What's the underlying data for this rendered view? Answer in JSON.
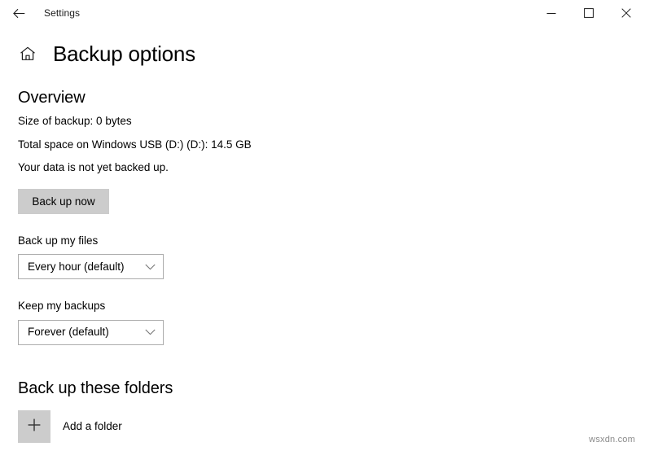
{
  "titlebar": {
    "back_icon": "arrow-left-icon",
    "title": "Settings",
    "minimize_icon": "minimize-icon",
    "maximize_icon": "maximize-icon",
    "close_icon": "close-icon"
  },
  "header": {
    "home_icon": "home-icon",
    "title": "Backup options"
  },
  "overview": {
    "heading": "Overview",
    "size_of_backup": "Size of backup: 0 bytes",
    "total_space": "Total space on Windows USB (D:) (D:): 14.5 GB",
    "status": "Your data is not yet backed up.",
    "backup_now_label": "Back up now"
  },
  "backup_frequency": {
    "label": "Back up my files",
    "value": "Every hour (default)",
    "chevron_icon": "chevron-down-icon"
  },
  "keep_backups": {
    "label": "Keep my backups",
    "value": "Forever (default)",
    "chevron_icon": "chevron-down-icon"
  },
  "folders": {
    "heading": "Back up these folders",
    "add_icon": "plus-icon",
    "add_label": "Add a folder"
  },
  "watermark": "wsxdn.com",
  "colors": {
    "button_gray": "#cccccc",
    "border_gray": "#adadad",
    "text": "#000000",
    "background": "#ffffff"
  }
}
